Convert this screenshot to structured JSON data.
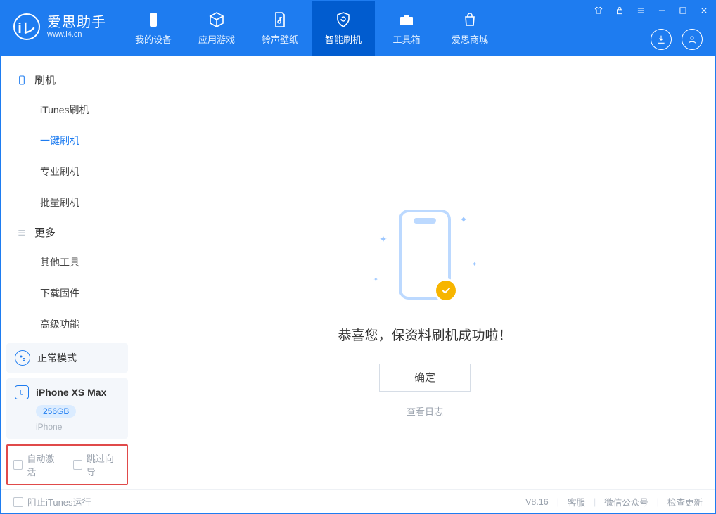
{
  "app": {
    "name_cn": "爱思助手",
    "url": "www.i4.cn"
  },
  "nav": {
    "my_device": "我的设备",
    "apps_games": "应用游戏",
    "ringtones": "铃声壁纸",
    "flash": "智能刷机",
    "toolbox": "工具箱",
    "store": "爱思商城"
  },
  "sidebar": {
    "section_flash": "刷机",
    "items_flash": [
      "iTunes刷机",
      "一键刷机",
      "专业刷机",
      "批量刷机"
    ],
    "section_more": "更多",
    "items_more": [
      "其他工具",
      "下载固件",
      "高级功能"
    ]
  },
  "mode": {
    "label": "正常模式"
  },
  "device": {
    "name": "iPhone XS Max",
    "storage": "256GB",
    "type": "iPhone"
  },
  "options": {
    "auto_activate": "自动激活",
    "skip_guide": "跳过向导"
  },
  "main": {
    "success_text": "恭喜您，保资料刷机成功啦！",
    "ok": "确定",
    "view_log": "查看日志"
  },
  "footer": {
    "block_itunes": "阻止iTunes运行",
    "version": "V8.16",
    "support": "客服",
    "wechat": "微信公众号",
    "update": "检查更新"
  }
}
